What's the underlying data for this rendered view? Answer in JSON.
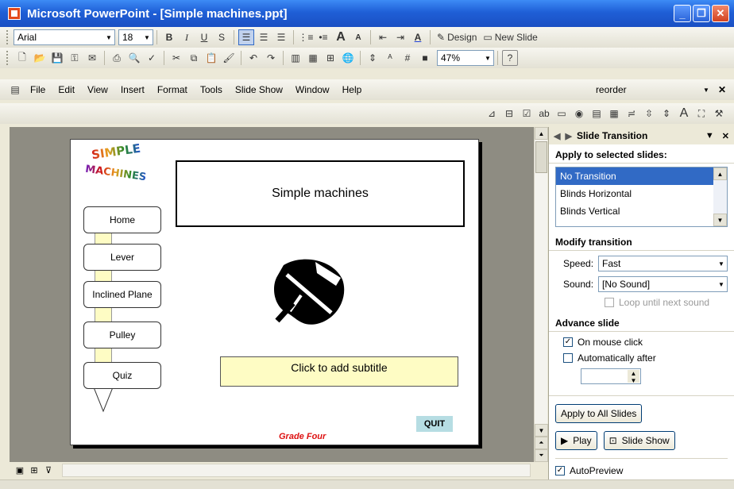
{
  "window": {
    "title": "Microsoft PowerPoint - [Simple machines.ppt]",
    "minimize": "_",
    "restore": "❐",
    "close": "✕"
  },
  "formatting": {
    "font": "Arial",
    "size": "18",
    "bold": "B",
    "italic": "I",
    "underline": "U",
    "shadow": "S",
    "design_label": "Design",
    "new_slide_label": "New Slide"
  },
  "standard": {
    "zoom": "47%",
    "help": "?"
  },
  "menu": {
    "items": [
      "File",
      "Edit",
      "View",
      "Insert",
      "Format",
      "Tools",
      "Slide Show",
      "Window",
      "Help"
    ],
    "ask_box": "reorder"
  },
  "slide": {
    "logo_simple": "SIMPLE",
    "logo_machines": "MACHINES",
    "nav_buttons": [
      "Home",
      "Lever",
      "Inclined Plane",
      "Pulley",
      "Quiz"
    ],
    "title": "Simple machines",
    "subtitle_placeholder": "Click to add subtitle",
    "quit": "QUIT",
    "grade": "Grade Four"
  },
  "task_pane": {
    "title": "Slide Transition",
    "apply_section": "Apply to selected slides:",
    "transitions": [
      "No Transition",
      "Blinds Horizontal",
      "Blinds Vertical"
    ],
    "selected_transition": "No Transition",
    "modify_section": "Modify transition",
    "speed_label": "Speed:",
    "speed_value": "Fast",
    "sound_label": "Sound:",
    "sound_value": "[No Sound]",
    "loop_label": "Loop until next sound",
    "advance_section": "Advance slide",
    "on_click_label": "On mouse click",
    "on_click_checked": true,
    "auto_label": "Automatically after",
    "auto_checked": false,
    "apply_all": "Apply to All Slides",
    "play": "Play",
    "slide_show": "Slide Show",
    "autopreview_label": "AutoPreview",
    "autopreview_checked": true
  },
  "colors": {
    "title_bar": "#1f5fd6",
    "selection": "#316ac5",
    "subtitle_fill": "#fefcc4",
    "quit_fill": "#b6dde3",
    "grade_text": "#dd1111"
  }
}
